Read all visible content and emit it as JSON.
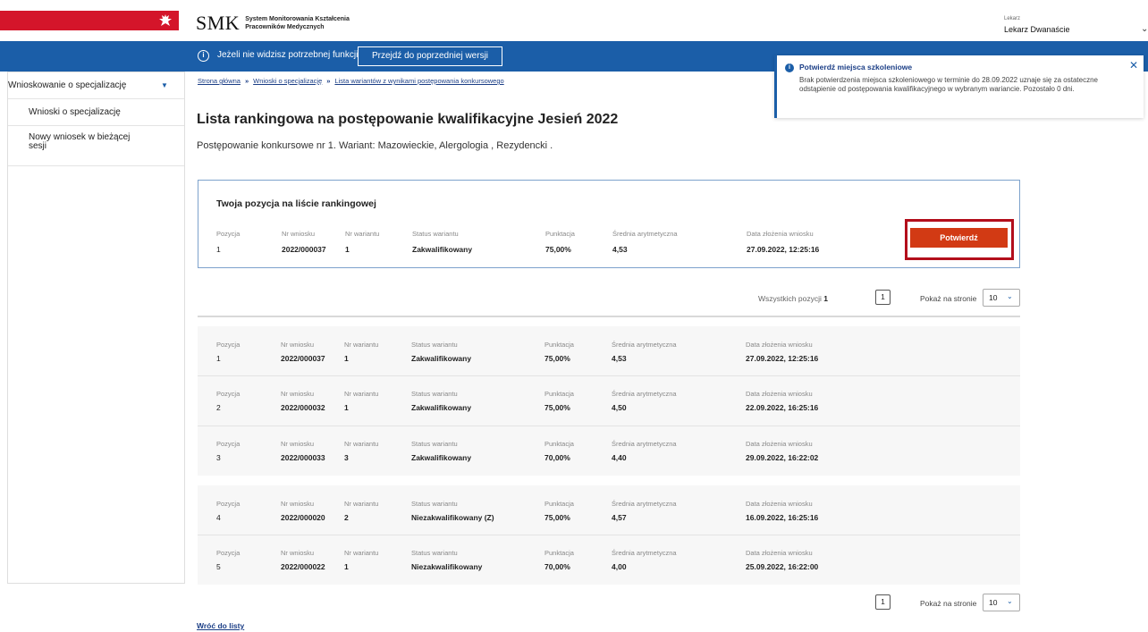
{
  "header": {
    "logo_text": "SMK",
    "logo_sub1": "System Monitorowania Kształcenia",
    "logo_sub2": "Pracowników Medycznych",
    "user_role": "Lekarz",
    "user_name": "Lekarz Dwanaście"
  },
  "banner": {
    "text": "Jeżeli nie widzisz potrzebnej funkcji",
    "button": "Przejdź do poprzedniej wersji"
  },
  "sidebar": {
    "section": "Wnioskowanie o specjalizację",
    "items": [
      {
        "label": "Wnioski o specjalizację"
      },
      {
        "label": "Nowy wniosek w bieżącej sesji"
      }
    ]
  },
  "breadcrumb": [
    "Strona główna",
    "Wnioski o specjalizację",
    "Lista wariantów z wynikami postępowania konkursowego"
  ],
  "page": {
    "title": "Lista rankingowa na postępowanie kwalifikacyjne Jesień 2022",
    "subtitle": "Postępowanie konkursowe nr 1. Wariant: Mazowieckie, Alergologia , Rezydencki ."
  },
  "toast": {
    "title": "Potwierdź miejsca szkoleniowe",
    "body": "Brak potwierdzenia miejsca szkoleniowego w terminie do 28.09.2022 uznaje się za ostateczne odstąpienie od postępowania kwalifikacyjnego w wybranym wariancie. Pozostało 0 dni."
  },
  "labels": {
    "pozycja": "Pozycja",
    "nr_wniosku": "Nr wniosku",
    "nr_wariantu": "Nr wariantu",
    "status": "Status wariantu",
    "punktacja": "Punktacja",
    "srednia": "Średnia arytmetyczna",
    "data": "Data złożenia wniosku"
  },
  "my_rank": {
    "title": "Twoja pozycja na liście rankingowej",
    "pozycja": "1",
    "nr_wniosku": "2022/000037",
    "nr_wariantu": "1",
    "status": "Zakwalifikowany",
    "punktacja": "75,00%",
    "srednia": "4,53",
    "data": "27.09.2022, 12:25:16",
    "confirm": "Potwierdź"
  },
  "pagination": {
    "total_label": "Wszystkich pozycji",
    "total": "1",
    "page": "1",
    "per_page_label": "Pokaż na stronie",
    "per_page": "10",
    "page_bottom": "1",
    "per_page_bottom": "10"
  },
  "rows": [
    {
      "pozycja": "1",
      "nr_wniosku": "2022/000037",
      "nr_wariantu": "1",
      "status": "Zakwalifikowany",
      "punktacja": "75,00%",
      "srednia": "4,53",
      "data": "27.09.2022, 12:25:16"
    },
    {
      "pozycja": "2",
      "nr_wniosku": "2022/000032",
      "nr_wariantu": "1",
      "status": "Zakwalifikowany",
      "punktacja": "75,00%",
      "srednia": "4,50",
      "data": "22.09.2022, 16:25:16"
    },
    {
      "pozycja": "3",
      "nr_wniosku": "2022/000033",
      "nr_wariantu": "3",
      "status": "Zakwalifikowany",
      "punktacja": "70,00%",
      "srednia": "4,40",
      "data": "29.09.2022, 16:22:02"
    },
    {
      "pozycja": "4",
      "nr_wniosku": "2022/000020",
      "nr_wariantu": "2",
      "status": "Niezakwalifikowany (Z)",
      "punktacja": "75,00%",
      "srednia": "4,57",
      "data": "16.09.2022, 16:25:16"
    },
    {
      "pozycja": "5",
      "nr_wniosku": "2022/000022",
      "nr_wariantu": "1",
      "status": "Niezakwalifikowany",
      "punktacja": "70,00%",
      "srednia": "4,00",
      "data": "25.09.2022, 16:22:00"
    }
  ],
  "back_link": "Wróć do listy",
  "colors": {
    "blue": "#1b5ea8",
    "red": "#d4152a",
    "confirm": "#d23a14",
    "highlight": "#b30e1b"
  }
}
